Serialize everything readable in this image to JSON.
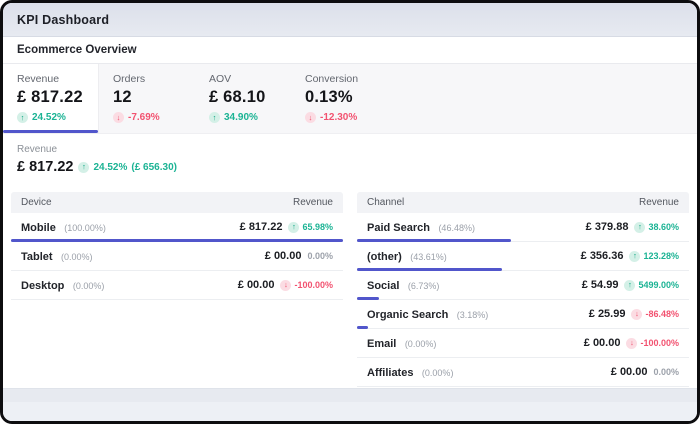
{
  "titlebar": {
    "title": "KPI Dashboard"
  },
  "section": {
    "title": "Ecommerce Overview"
  },
  "kpis": [
    {
      "label": "Revenue",
      "value": "£ 817.22",
      "delta": "24.52%",
      "direction": "up",
      "selected": true
    },
    {
      "label": "Orders",
      "value": "12",
      "delta": "-7.69%",
      "direction": "down",
      "selected": false
    },
    {
      "label": "AOV",
      "value": "£ 68.10",
      "delta": "34.90%",
      "direction": "up",
      "selected": false
    },
    {
      "label": "Conversion",
      "value": "0.13%",
      "delta": "-12.30%",
      "direction": "down",
      "selected": false
    }
  ],
  "detail": {
    "label": "Revenue",
    "value": "£ 817.22",
    "delta": "24.52%",
    "previous": "(£ 656.30)",
    "direction": "up"
  },
  "tables": [
    {
      "dimension_header": "Device",
      "value_header": "Revenue",
      "rows": [
        {
          "name": "Mobile",
          "share": "(100.00%)",
          "share_pct": 100,
          "value": "£ 817.22",
          "delta": "65.98%",
          "direction": "up"
        },
        {
          "name": "Tablet",
          "share": "(0.00%)",
          "share_pct": 0,
          "value": "£ 00.00",
          "delta": "0.00%",
          "direction": "flat"
        },
        {
          "name": "Desktop",
          "share": "(0.00%)",
          "share_pct": 0,
          "value": "£ 00.00",
          "delta": "-100.00%",
          "direction": "down"
        }
      ]
    },
    {
      "dimension_header": "Channel",
      "value_header": "Revenue",
      "rows": [
        {
          "name": "Paid Search",
          "share": "(46.48%)",
          "share_pct": 46.48,
          "value": "£ 379.88",
          "delta": "38.60%",
          "direction": "up"
        },
        {
          "name": "(other)",
          "share": "(43.61%)",
          "share_pct": 43.61,
          "value": "£ 356.36",
          "delta": "123.28%",
          "direction": "up"
        },
        {
          "name": "Social",
          "share": "(6.73%)",
          "share_pct": 6.73,
          "value": "£ 54.99",
          "delta": "5499.00%",
          "direction": "up"
        },
        {
          "name": "Organic Search",
          "share": "(3.18%)",
          "share_pct": 3.18,
          "value": "£ 25.99",
          "delta": "-86.48%",
          "direction": "down"
        },
        {
          "name": "Email",
          "share": "(0.00%)",
          "share_pct": 0,
          "value": "£ 00.00",
          "delta": "-100.00%",
          "direction": "down"
        },
        {
          "name": "Affiliates",
          "share": "(0.00%)",
          "share_pct": 0,
          "value": "£ 00.00",
          "delta": "0.00%",
          "direction": "flat"
        }
      ]
    }
  ],
  "colors": {
    "accent": "#5156cb",
    "positive": "#1bb394",
    "negative": "#f25270",
    "neutral": "#9ca1aa"
  }
}
